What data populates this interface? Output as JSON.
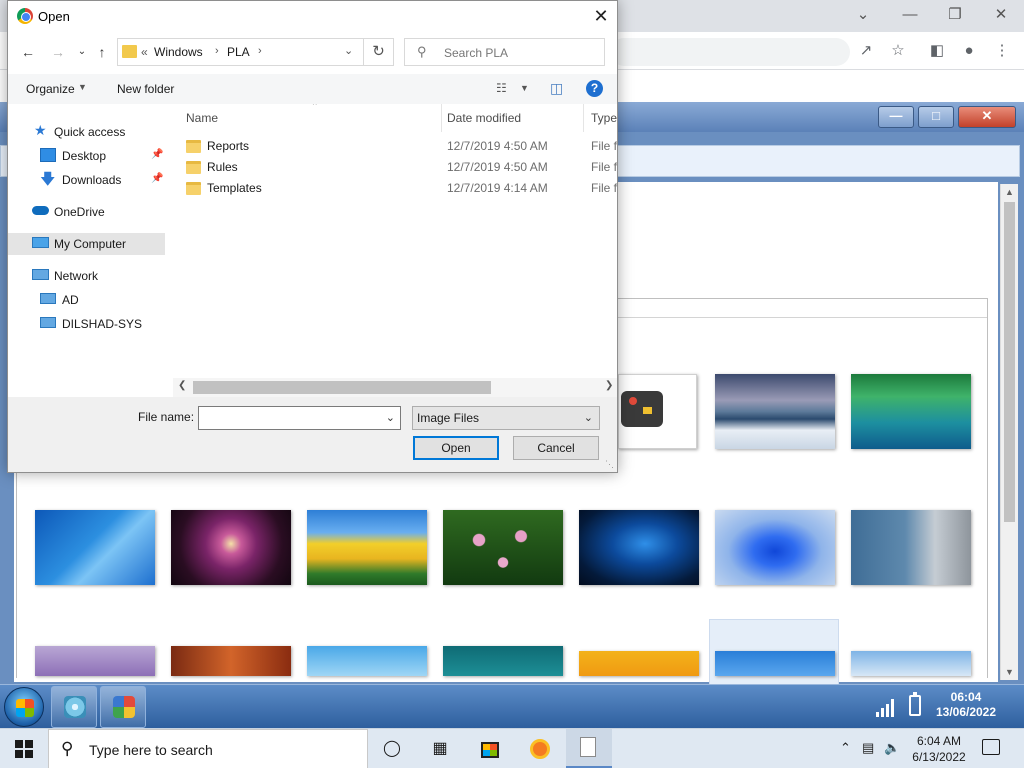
{
  "dialog": {
    "title": "Open",
    "breadcrumb": {
      "overflow": "«",
      "segments": [
        "Windows",
        "PLA"
      ]
    },
    "search_placeholder": "Search PLA",
    "toolbar": {
      "organize": "Organize",
      "new_folder": "New folder"
    },
    "navigation": [
      {
        "label": "Quick access",
        "icon": "star-icon",
        "pinned": false
      },
      {
        "label": "Desktop",
        "icon": "desktop-icon",
        "pinned": true
      },
      {
        "label": "Downloads",
        "icon": "download-icon",
        "pinned": true
      },
      {
        "label": "OneDrive",
        "icon": "cloud-icon",
        "pinned": false
      },
      {
        "label": "My Computer",
        "icon": "computer-icon",
        "pinned": false,
        "selected": true
      },
      {
        "label": "Network",
        "icon": "network-icon",
        "pinned": false
      },
      {
        "label": "AD",
        "icon": "monitor-icon",
        "pinned": false
      },
      {
        "label": "DILSHAD-SYS",
        "icon": "monitor-icon",
        "pinned": false
      }
    ],
    "columns": [
      "Name",
      "Date modified",
      "Type"
    ],
    "files": [
      {
        "name": "Reports",
        "date": "12/7/2019 4:50 AM",
        "type": "File fo"
      },
      {
        "name": "Rules",
        "date": "12/7/2019 4:50 AM",
        "type": "File fo"
      },
      {
        "name": "Templates",
        "date": "12/7/2019 4:14 AM",
        "type": "File fo"
      }
    ],
    "file_name_label": "File name:",
    "file_name_value": "",
    "file_type": "Image Files",
    "open_button": "Open",
    "cancel_button": "Cancel"
  },
  "remote_taskbar": {
    "time": "06:04",
    "date": "13/06/2022"
  },
  "taskbar": {
    "search_placeholder": "Type here to search",
    "time": "6:04 AM",
    "date": "6/13/2022"
  },
  "colors": {
    "accent": "#0078d7",
    "win7_taskbar": "#3f6fae",
    "folder": "#f6d16a"
  }
}
